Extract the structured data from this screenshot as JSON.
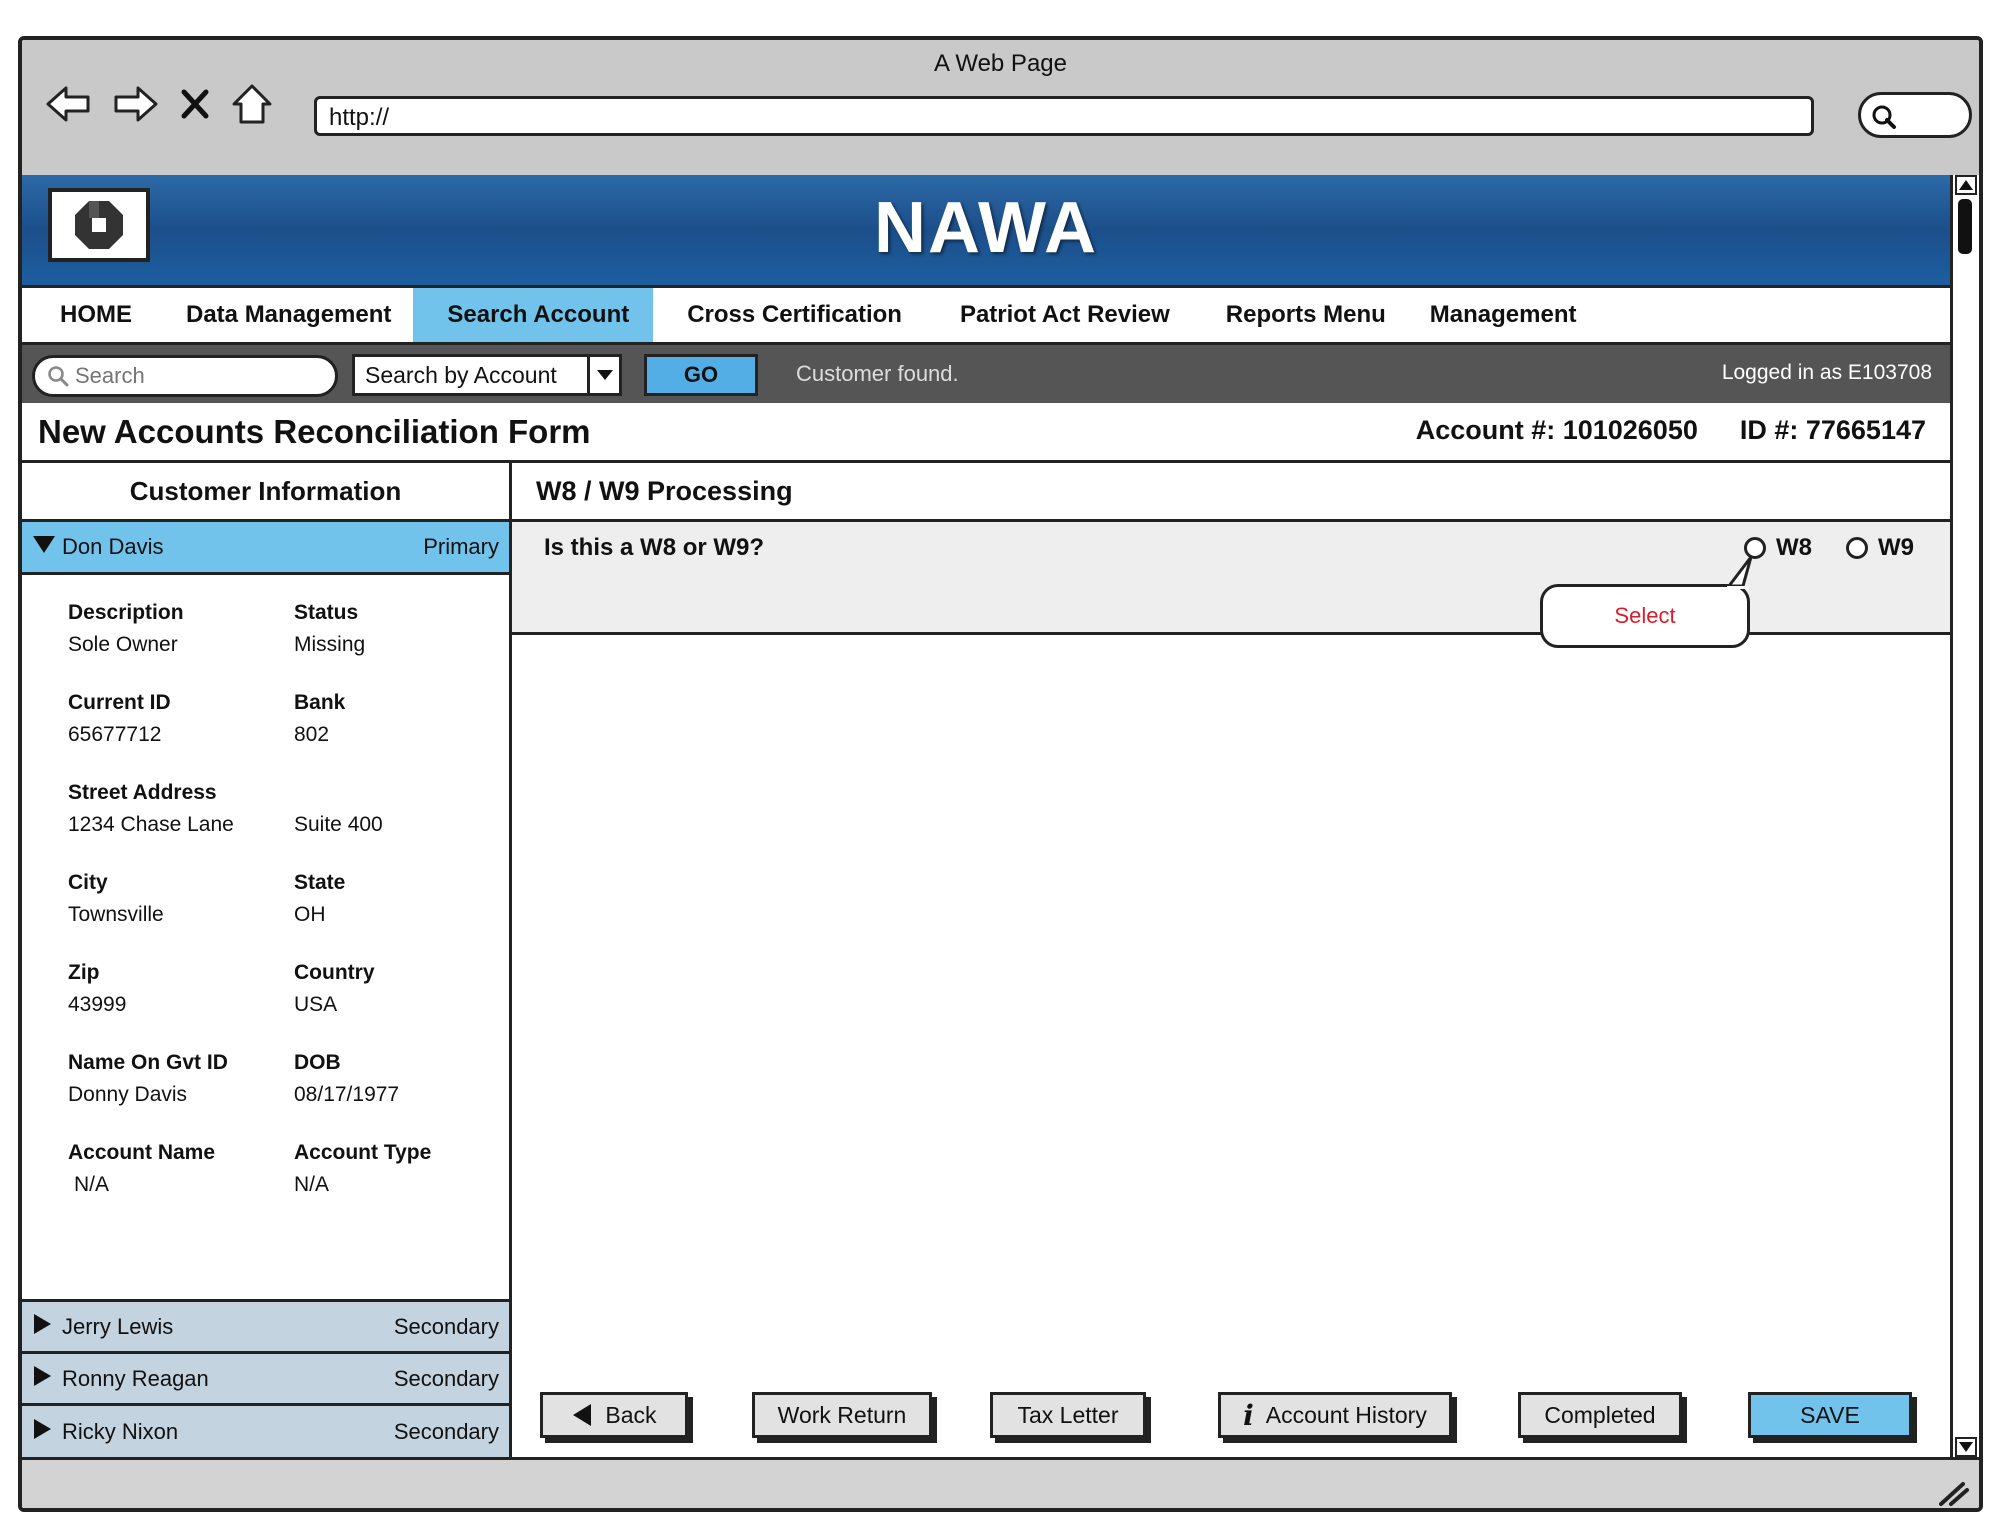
{
  "window": {
    "title": "A Web Page",
    "url": "http://"
  },
  "brand": {
    "name": "NAWA"
  },
  "menu": [
    {
      "label": "HOME",
      "active": false
    },
    {
      "label": "Data Management",
      "active": false
    },
    {
      "label": "Search Account",
      "active": true
    },
    {
      "label": "Cross Certification",
      "active": false
    },
    {
      "label": "Patriot Act Review",
      "active": false
    },
    {
      "label": "Reports Menu",
      "active": false
    },
    {
      "label": "Management",
      "active": false
    }
  ],
  "toolbar": {
    "search_placeholder": "Search",
    "search_by": "Search by Account",
    "go_label": "GO",
    "status": "Customer found.",
    "login": "Logged in as E103708"
  },
  "form": {
    "title": "New Accounts Reconciliation Form",
    "account_label": "Account #: 101026050",
    "id_label": "ID #: 77665147"
  },
  "customers": {
    "heading": "Customer Information",
    "primary": {
      "name": "Don Davis",
      "role": "Primary"
    },
    "others": [
      {
        "name": "Jerry Lewis",
        "role": "Secondary"
      },
      {
        "name": "Ronny Reagan",
        "role": "Secondary"
      },
      {
        "name": "Ricky Nixon",
        "role": "Secondary"
      }
    ]
  },
  "details": {
    "description": {
      "label": "Description",
      "value": "Sole Owner"
    },
    "status": {
      "label": "Status",
      "value": "Missing"
    },
    "current_id": {
      "label": "Current ID",
      "value": "65677712"
    },
    "bank": {
      "label": "Bank",
      "value": "802"
    },
    "street": {
      "label": "Street Address",
      "value": "1234 Chase Lane"
    },
    "suite": {
      "label": "",
      "value": "Suite 400"
    },
    "city": {
      "label": "City",
      "value": "Townsville"
    },
    "state": {
      "label": "State",
      "value": "OH"
    },
    "zip": {
      "label": "Zip",
      "value": "43999"
    },
    "country": {
      "label": "Country",
      "value": "USA"
    },
    "gvt_name": {
      "label": "Name On Gvt ID",
      "value": "Donny Davis"
    },
    "dob": {
      "label": "DOB",
      "value": "08/17/1977"
    },
    "account_name": {
      "label": "Account Name",
      "value": "N/A"
    },
    "account_type": {
      "label": "Account Type",
      "value": "N/A"
    }
  },
  "processing": {
    "heading": "W8 / W9 Processing",
    "question": "Is this a W8 or W9?",
    "options": [
      "W8",
      "W9"
    ],
    "callout": "Select"
  },
  "buttons": {
    "back": "Back",
    "work_return": "Work Return",
    "tax_letter": "Tax Letter",
    "account_history": "Account History",
    "completed": "Completed",
    "save": "SAVE"
  },
  "colors": {
    "banner": "#1b4f8a",
    "accent": "#72c3ec",
    "go": "#54aee6",
    "callout_text": "#d81e2a",
    "toolbar": "#555555"
  }
}
